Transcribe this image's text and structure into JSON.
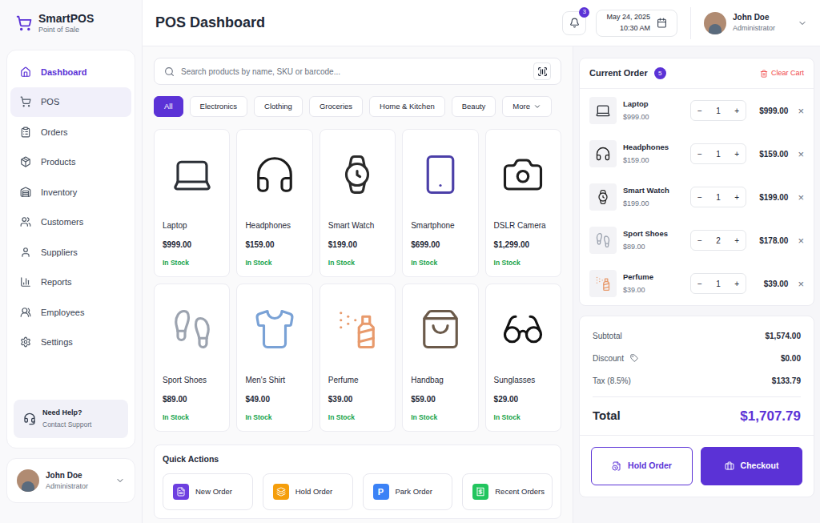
{
  "app": {
    "name": "SmartPOS",
    "subtitle": "Point of Sale"
  },
  "sidebar": {
    "items": [
      {
        "label": "Dashboard",
        "selected": true,
        "highlighted": false
      },
      {
        "label": "POS",
        "selected": false,
        "highlighted": true
      },
      {
        "label": "Orders",
        "selected": false,
        "highlighted": false
      },
      {
        "label": "Products",
        "selected": false,
        "highlighted": false
      },
      {
        "label": "Inventory",
        "selected": false,
        "highlighted": false
      },
      {
        "label": "Customers",
        "selected": false,
        "highlighted": false
      },
      {
        "label": "Suppliers",
        "selected": false,
        "highlighted": false
      },
      {
        "label": "Reports",
        "selected": false,
        "highlighted": false
      },
      {
        "label": "Employees",
        "selected": false,
        "highlighted": false
      },
      {
        "label": "Settings",
        "selected": false,
        "highlighted": false
      }
    ],
    "help": {
      "title": "Need Help?",
      "subtitle": "Contact Support"
    },
    "user": {
      "name": "John Doe",
      "role": "Administrator"
    }
  },
  "header": {
    "title": "POS Dashboard",
    "notifications": "3",
    "date": "May 24, 2025",
    "time": "10:30 AM",
    "user": {
      "name": "John Doe",
      "role": "Administrator"
    }
  },
  "search": {
    "placeholder": "Search products by name, SKU or barcode..."
  },
  "categories": [
    {
      "label": "All",
      "selected": true,
      "dropdown": false
    },
    {
      "label": "Electronics",
      "selected": false,
      "dropdown": false
    },
    {
      "label": "Clothing",
      "selected": false,
      "dropdown": false
    },
    {
      "label": "Groceries",
      "selected": false,
      "dropdown": false
    },
    {
      "label": "Home & Kitchen",
      "selected": false,
      "dropdown": false
    },
    {
      "label": "Beauty",
      "selected": false,
      "dropdown": false
    },
    {
      "label": "More",
      "selected": false,
      "dropdown": true
    }
  ],
  "products": [
    {
      "name": "Laptop",
      "price": "$999.00",
      "stock": "In Stock"
    },
    {
      "name": "Headphones",
      "price": "$159.00",
      "stock": "In Stock"
    },
    {
      "name": "Smart Watch",
      "price": "$199.00",
      "stock": "In Stock"
    },
    {
      "name": "Smartphone",
      "price": "$699.00",
      "stock": "In Stock"
    },
    {
      "name": "DSLR Camera",
      "price": "$1,299.00",
      "stock": "In Stock"
    },
    {
      "name": "Sport Shoes",
      "price": "$89.00",
      "stock": "In Stock"
    },
    {
      "name": "Men's Shirt",
      "price": "$49.00",
      "stock": "In Stock"
    },
    {
      "name": "Perfume",
      "price": "$39.00",
      "stock": "In Stock"
    },
    {
      "name": "Handbag",
      "price": "$59.00",
      "stock": "In Stock"
    },
    {
      "name": "Sunglasses",
      "price": "$29.00",
      "stock": "In Stock"
    }
  ],
  "quick_actions": {
    "title": "Quick Actions",
    "items": [
      {
        "label": "New Order",
        "color": "#6d3fe0",
        "glyph": ""
      },
      {
        "label": "Hold Order",
        "color": "#f59e0b",
        "glyph": ""
      },
      {
        "label": "Park Order",
        "color": "#3b82f6",
        "glyph": "P"
      },
      {
        "label": "Recent Orders",
        "color": "#22c55e",
        "glyph": ""
      }
    ]
  },
  "order": {
    "title": "Current Order",
    "count": "5",
    "clear": "Clear Cart",
    "minus": "−",
    "plus": "+",
    "remove": "×",
    "items": [
      {
        "name": "Laptop",
        "price": "$999.00",
        "qty": "1",
        "total": "$999.00"
      },
      {
        "name": "Headphones",
        "price": "$159.00",
        "qty": "1",
        "total": "$159.00"
      },
      {
        "name": "Smart Watch",
        "price": "$199.00",
        "qty": "1",
        "total": "$199.00"
      },
      {
        "name": "Sport Shoes",
        "price": "$89.00",
        "qty": "2",
        "total": "$178.00"
      },
      {
        "name": "Perfume",
        "price": "$39.00",
        "qty": "1",
        "total": "$39.00"
      }
    ],
    "summary": [
      {
        "label": "Subtotal",
        "value": "$1,574.00",
        "kind": "plain"
      },
      {
        "label": "Discount",
        "value": "$0.00",
        "kind": "tag"
      },
      {
        "label": "Tax (8.5%)",
        "value": "$133.79",
        "kind": "plain"
      }
    ],
    "total": {
      "label": "Total",
      "value": "$1,707.79"
    },
    "buttons": [
      {
        "label": "Hold Order",
        "kind": "outline"
      },
      {
        "label": "Checkout",
        "kind": "primary"
      }
    ]
  }
}
